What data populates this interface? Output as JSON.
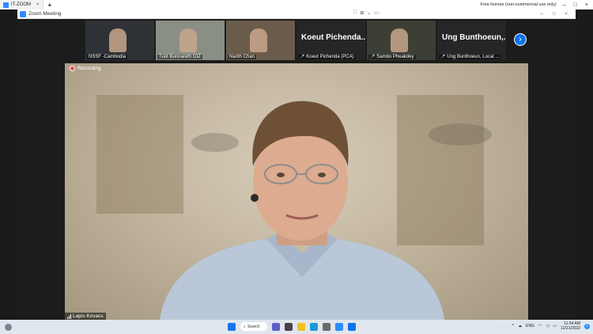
{
  "outer": {
    "tab_title": "IT-ZOOM",
    "tab_close": "×",
    "new_tab": "+",
    "license_text": "Free license (non-commercial use only)",
    "controls": [
      "–",
      "□",
      "×"
    ]
  },
  "zoom": {
    "window_title": "Zoom Meeting",
    "center_icons": [
      "⛶",
      "⊞",
      "⌄",
      "▭"
    ],
    "controls": [
      "–",
      "□",
      "×"
    ]
  },
  "participants": [
    {
      "name": "NSSF -Cambodia",
      "muted": false,
      "show_big_name": false,
      "bg": "#2e3135"
    },
    {
      "name": "Tuot Bunnareth GIZ",
      "muted": false,
      "show_big_name": false,
      "bg": "#8a8f86"
    },
    {
      "name": "Narith Chan",
      "muted": false,
      "show_big_name": false,
      "bg": "#6b5b4b"
    },
    {
      "name": "Koeut Pichenda (PCA)",
      "big_name": "Koeut Pichenda...",
      "muted": true,
      "show_big_name": true,
      "bg": "#262626"
    },
    {
      "name": "Sambo Pheakdey",
      "muted": true,
      "show_big_name": false,
      "bg": "#3b3f36"
    },
    {
      "name": "Ung Bunthoeun, Local ...",
      "big_name": "Ung Bunthoeun,...",
      "muted": true,
      "show_big_name": true,
      "bg": "#262626"
    }
  ],
  "next_button": "›",
  "main": {
    "recording_label": "Recording",
    "speaker_name": "Lajos Kovacs"
  },
  "taskbar": {
    "search_label": "Search",
    "language": "ENG",
    "time": "11:54 AM",
    "date": "12/21/2022",
    "notification_count": "1"
  }
}
